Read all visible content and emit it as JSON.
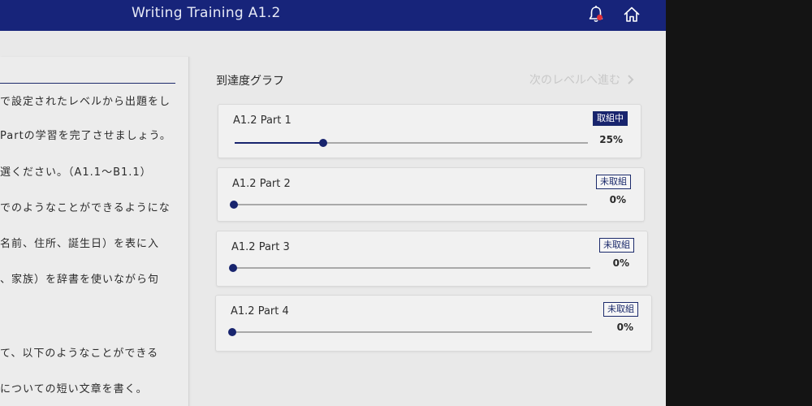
{
  "header": {
    "title": "Writing Training A1.2",
    "notification_icon": "bell-icon",
    "home_icon": "home-icon",
    "accent_color": "#17247a"
  },
  "left_panel": {
    "lines": [
      "で設定されたレベルから出題をし",
      "Partの学習を完了させましょう。",
      "選ください。（A1.1～B1.1）",
      "でのようなことができるようにな",
      "名前、住所、誕生日）を表に入",
      "、家族）を辞書を使いながら句",
      "て、以下のようなことができる",
      "についての短い文章を書く。"
    ]
  },
  "progress": {
    "title": "到達度グラフ",
    "next_level_label": "次のレベルへ進む",
    "next_icon": "chevron-right-icon",
    "parts": [
      {
        "label": "A1.2 Part 1",
        "status": "取組中",
        "percent_label": "25%",
        "progress": 0.25,
        "active": true
      },
      {
        "label": "A1.2 Part 2",
        "status": "未取組",
        "percent_label": "0%",
        "progress": 0,
        "active": false
      },
      {
        "label": "A1.2 Part 3",
        "status": "未取組",
        "percent_label": "0%",
        "progress": 0,
        "active": false
      },
      {
        "label": "A1.2 Part 4",
        "status": "未取組",
        "percent_label": "0%",
        "progress": 0,
        "active": false
      }
    ]
  }
}
